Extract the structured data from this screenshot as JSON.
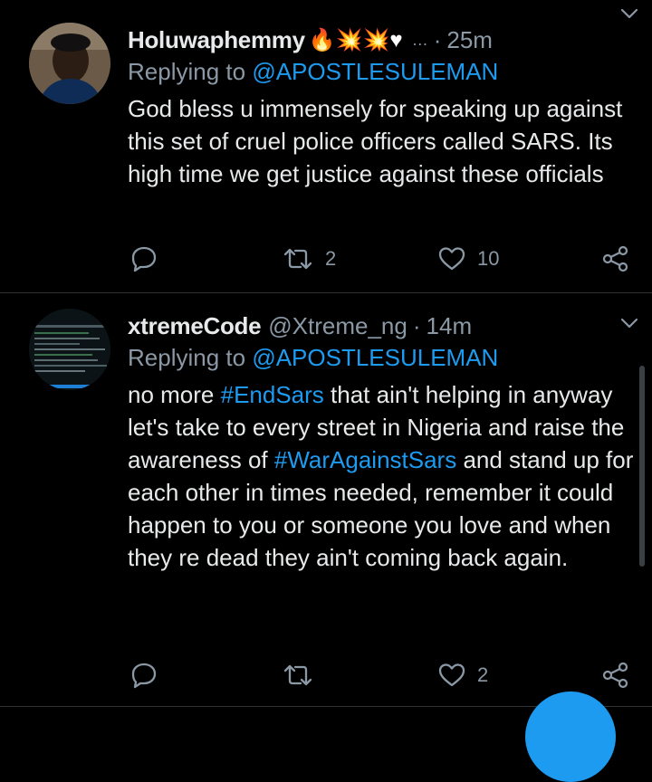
{
  "tweets": [
    {
      "author": "Holuwaphemmy",
      "emojis": "🔥💥💥♥",
      "ellipsis": "…",
      "time": "25m",
      "replying_prefix": "Replying to ",
      "replying_to": "@APOSTLESULEMAN",
      "text": "God bless u immensely  for speaking up against this set of cruel police officers called SARS. Its high time we get justice against these officials",
      "retweets": "2",
      "likes": "10"
    },
    {
      "author": "xtremeCode",
      "handle": "@Xtreme_ng",
      "time": "14m",
      "replying_prefix": "Replying to ",
      "replying_to": "@APOSTLESULEMAN",
      "text_parts": [
        "no more ",
        "#EndSars",
        " that ain't helping in anyway let's take to every street in Nigeria and raise the awareness of ",
        "#WarAgainstSars",
        " and stand up for each other in times needed, remember it could happen to you or someone you love and when they re dead they ain't coming back again."
      ],
      "retweets": "",
      "likes": "2"
    }
  ],
  "colors": {
    "background": "#000000",
    "text": "#e7e9ea",
    "muted": "#8b98a5",
    "link": "#1d9bf0",
    "divider": "#2f3336"
  },
  "icons": [
    "reply-icon",
    "retweet-icon",
    "like-icon",
    "share-icon",
    "chevron-down-icon"
  ]
}
